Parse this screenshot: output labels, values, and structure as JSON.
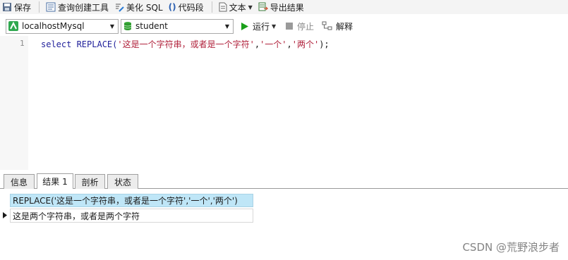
{
  "toolbar": {
    "save_label": "保存",
    "query_builder_label": "查询创建工具",
    "beautify_label": "美化 SQL",
    "snippet_label": "代码段",
    "text_label": "文本",
    "export_label": "导出结果"
  },
  "connection_bar": {
    "connection": "localhostMysql",
    "database": "student",
    "run_label": "运行",
    "stop_label": "停止",
    "explain_label": "解释"
  },
  "editor": {
    "line_number": "1",
    "code": {
      "keyword": "select REPLACE(",
      "arg1": "'这是一个字符串，或者是一个字符'",
      "comma1": ",",
      "arg2": "'一个'",
      "comma2": ",",
      "arg3": "'两个'",
      "tail": ");"
    }
  },
  "result_tabs": [
    "信息",
    "结果 1",
    "剖析",
    "状态"
  ],
  "result_grid": {
    "column_header": "REPLACE('这是一个字符串，或者是一个字符','一个','两个')",
    "rows": [
      "这是两个字符串，或者是两个字符"
    ]
  },
  "watermark": "CSDN @荒野浪步者",
  "colors": {
    "keyword": "#1f1f9a",
    "string": "#b0203a",
    "header_bg": "#bfe6f7",
    "run_green": "#1aa01a"
  }
}
